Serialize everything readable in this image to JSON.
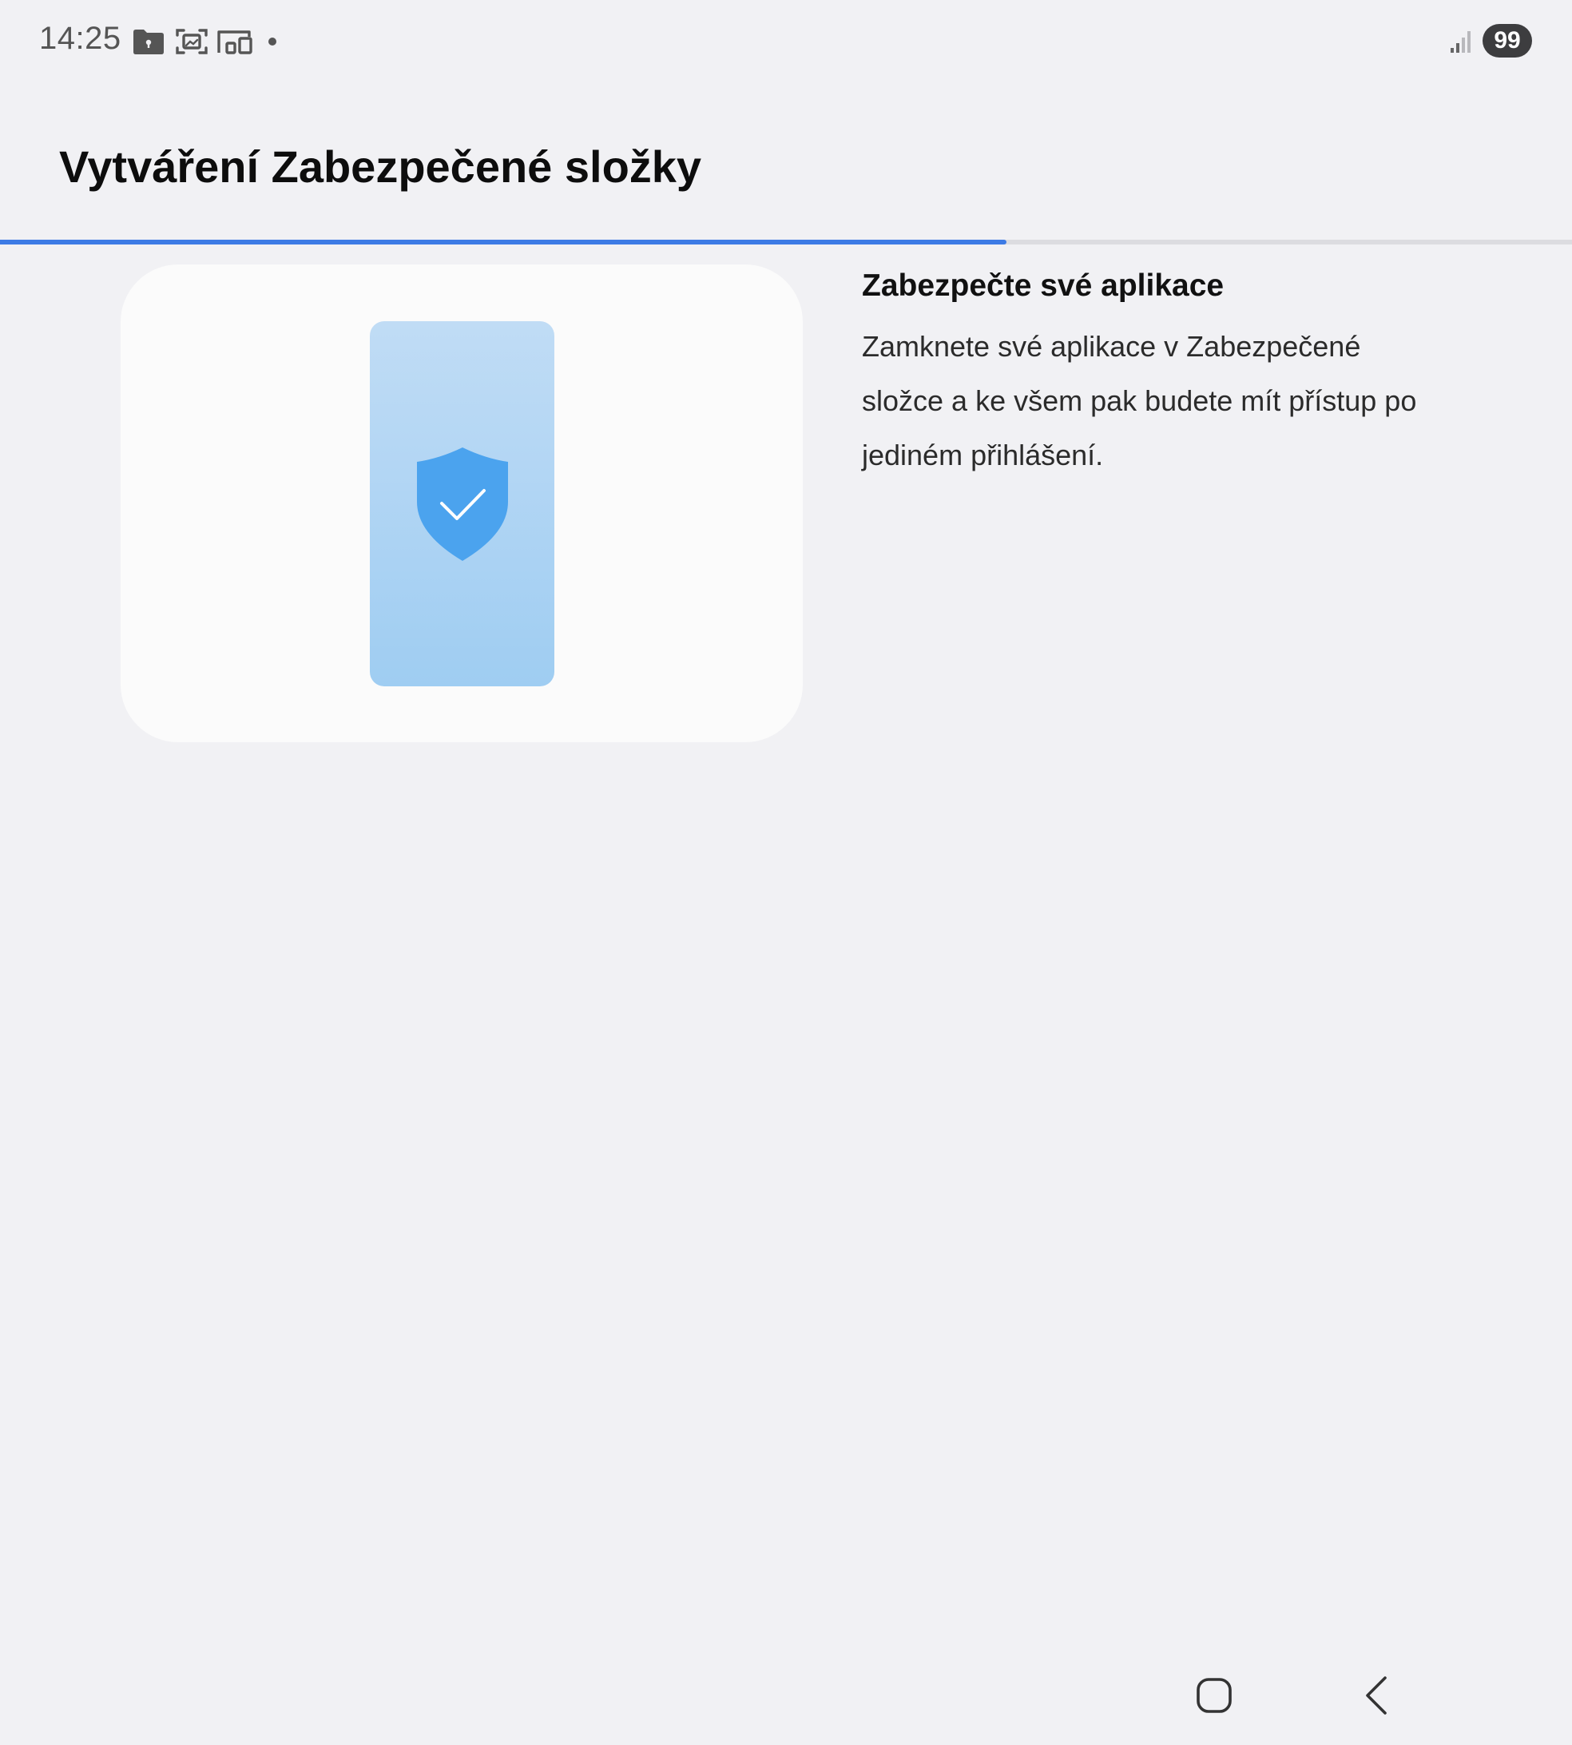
{
  "status_bar": {
    "time": "14:25",
    "icons": [
      "secure-folder-icon",
      "screenshot-icon",
      "devices-icon",
      "notification-dot",
      "signal-icon"
    ],
    "battery": "99"
  },
  "header": {
    "title": "Vytváření Zabezpečené složky"
  },
  "progress": {
    "fraction": 0.64,
    "fill_color": "#3d7be5",
    "track_color": "#dcdce0"
  },
  "illustration": {
    "icon": "shield-check-icon",
    "shield_color": "#4ba3ee",
    "phone_color": "#b2d6f4"
  },
  "content": {
    "heading": "Zabezpečte své aplikace",
    "body": "Zamknete své aplikace v Zabezpečené složce a ke všem pak budete mít přístup po jediném přihlášení."
  },
  "nav_bar": {
    "buttons": [
      "home-icon",
      "back-icon"
    ]
  }
}
